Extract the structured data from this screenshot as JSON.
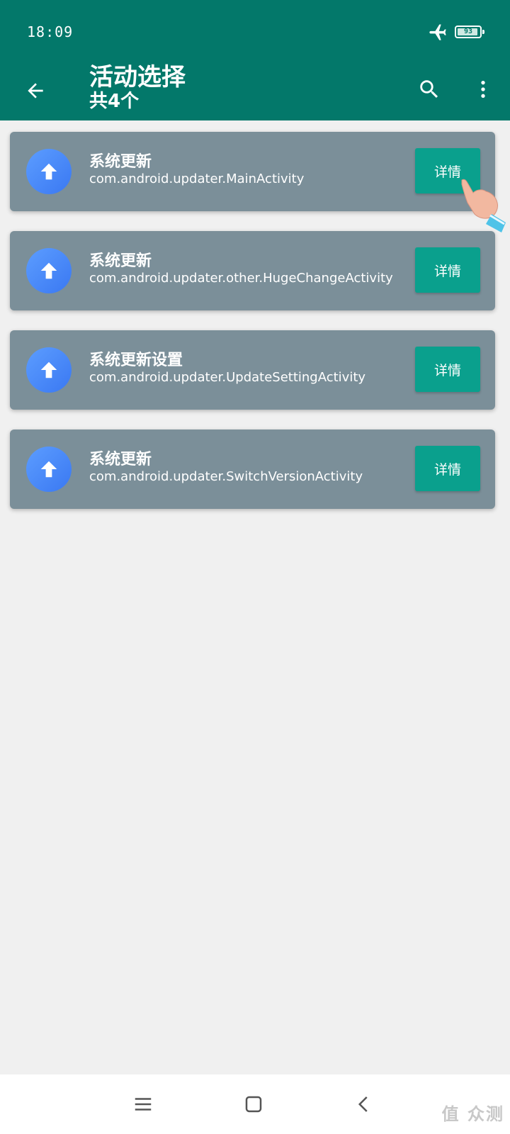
{
  "status_bar": {
    "time": "18:09",
    "battery_level": "93",
    "icons": [
      "airplane-icon",
      "battery-icon"
    ]
  },
  "app_bar": {
    "title": "活动选择",
    "subtitle": "共4个",
    "icons": {
      "back": "arrow-left-icon",
      "search": "search-icon",
      "more": "more-vertical-icon"
    }
  },
  "activities": [
    {
      "title": "系统更新",
      "component": "com.android.updater.MainActivity",
      "button_label": "详情",
      "icon": "arrow-up-icon"
    },
    {
      "title": "系统更新",
      "component": "com.android.updater.other.HugeChangeActivity",
      "button_label": "详情",
      "icon": "arrow-up-icon"
    },
    {
      "title": "系统更新设置",
      "component": "com.android.updater.UpdateSettingActivity",
      "button_label": "详情",
      "icon": "arrow-up-icon"
    },
    {
      "title": "系统更新",
      "component": "com.android.updater.SwitchVersionActivity",
      "button_label": "详情",
      "icon": "arrow-up-icon"
    }
  ],
  "nav_bar": {
    "icons": [
      "menu-icon",
      "home-square-icon",
      "back-chevron-icon"
    ]
  },
  "watermark": "值 众测",
  "colors": {
    "primary": "#03786a",
    "card": "#7b8f99",
    "button": "#0aa08d",
    "icon_circle": "#4a87f7",
    "background": "#f0f0f0"
  }
}
